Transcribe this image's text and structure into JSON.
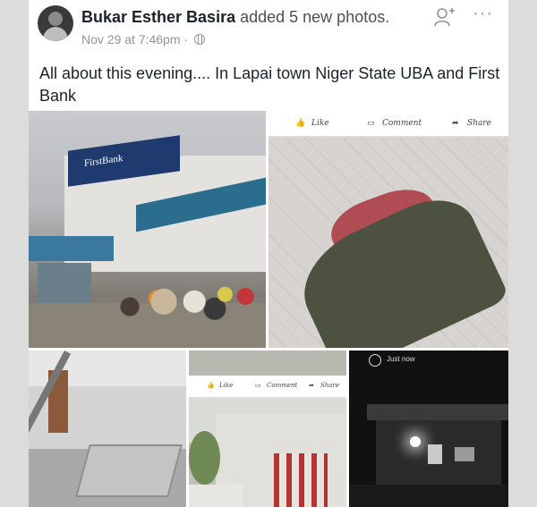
{
  "post": {
    "author": "Bukar Esther Basira",
    "action": " added 5 new photos.",
    "timestamp": "Nov 29 at 7:46pm",
    "separator": " · ",
    "caption": "All about this evening.... In Lapai town Niger State UBA  and First Bank"
  },
  "icons": [
    "add-friend-icon",
    "more-options-icon",
    "globe-icon"
  ],
  "photos": {
    "photo1": {
      "sign_text": "FirstBank"
    },
    "photo2": {
      "like_label": "Like",
      "comment_label": "Comment",
      "share_label": "Share"
    },
    "photo4": {
      "like_label": "Like",
      "comment_label": "Comment",
      "share_label": "Share"
    },
    "photo5": {
      "story_label": "Just now"
    }
  },
  "colors": {
    "author": "#1d2129",
    "meta": "#90949c",
    "firstbank_blue": "#1e3a6e"
  }
}
